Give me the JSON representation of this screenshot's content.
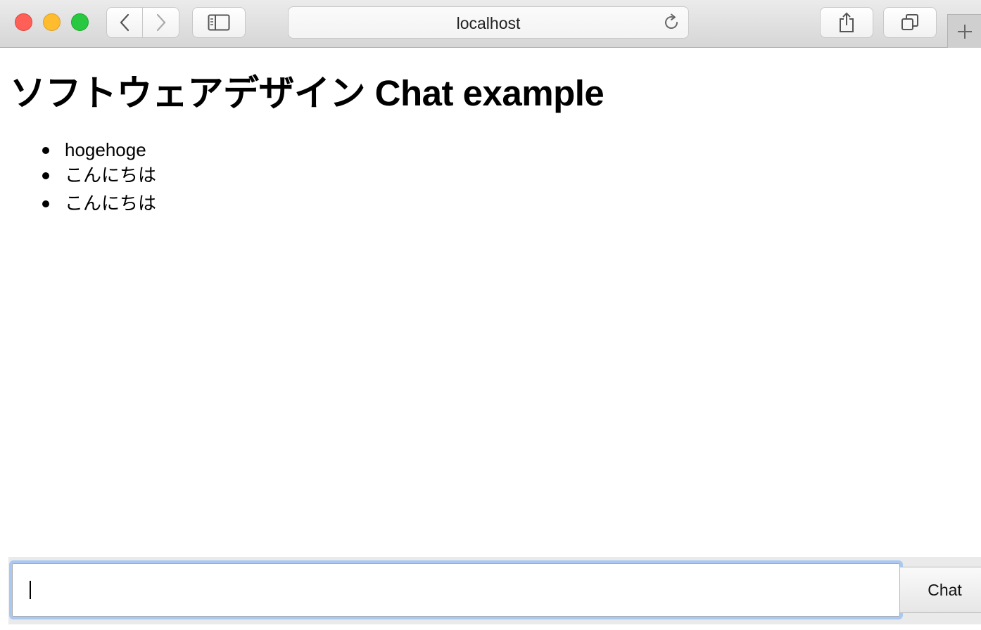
{
  "browser": {
    "url": "localhost",
    "icons": {
      "back": "chevron-left-icon",
      "forward": "chevron-right-icon",
      "sidebar": "sidebar-icon",
      "reload": "reload-icon",
      "share": "share-icon",
      "tabs": "tabs-overview-icon",
      "new_tab": "plus-icon"
    }
  },
  "page": {
    "title": "ソフトウェアデザイン Chat example",
    "messages": [
      "hogehoge",
      "こんにちは",
      "こんにちは"
    ]
  },
  "composer": {
    "input_value": "",
    "submit_label": "Chat"
  }
}
